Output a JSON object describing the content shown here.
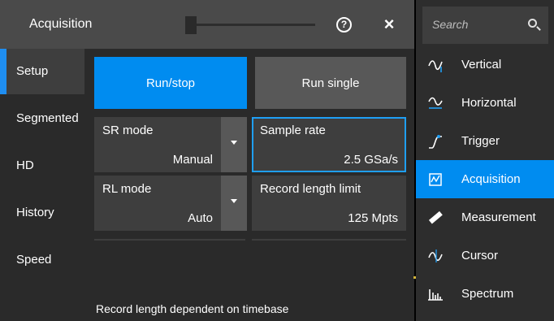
{
  "dialog": {
    "title": "Acquisition",
    "help_glyph": "?",
    "close_glyph": "×"
  },
  "tabs": [
    {
      "label": "Setup",
      "active": true
    },
    {
      "label": "Segmented",
      "active": false
    },
    {
      "label": "HD",
      "active": false
    },
    {
      "label": "History",
      "active": false
    },
    {
      "label": "Speed",
      "active": false
    }
  ],
  "content": {
    "run_stop_label": "Run/stop",
    "run_single_label": "Run single",
    "sr_mode": {
      "label": "SR mode",
      "value": "Manual"
    },
    "sample_rate": {
      "label": "Sample rate",
      "value": "2.5 GSa/s"
    },
    "rl_mode": {
      "label": "RL mode",
      "value": "Auto"
    },
    "record_length_limit": {
      "label": "Record length limit",
      "value": "125 Mpts"
    },
    "hint": "Record length dependent on timebase"
  },
  "sidebar": {
    "search_placeholder": "Search",
    "items": [
      {
        "label": "Vertical",
        "icon": "vertical-icon",
        "active": false
      },
      {
        "label": "Horizontal",
        "icon": "horizontal-icon",
        "active": false
      },
      {
        "label": "Trigger",
        "icon": "trigger-icon",
        "active": false
      },
      {
        "label": "Acquisition",
        "icon": "acquisition-icon",
        "active": true
      },
      {
        "label": "Measurement",
        "icon": "measurement-icon",
        "active": false
      },
      {
        "label": "Cursor",
        "icon": "cursor-icon",
        "active": false
      },
      {
        "label": "Spectrum",
        "icon": "spectrum-icon",
        "active": false
      }
    ]
  },
  "colors": {
    "accent": "#008cf0",
    "focus_border": "#1f9ff5",
    "panel": "#3e3e3e",
    "background": "#2a2a2a"
  }
}
